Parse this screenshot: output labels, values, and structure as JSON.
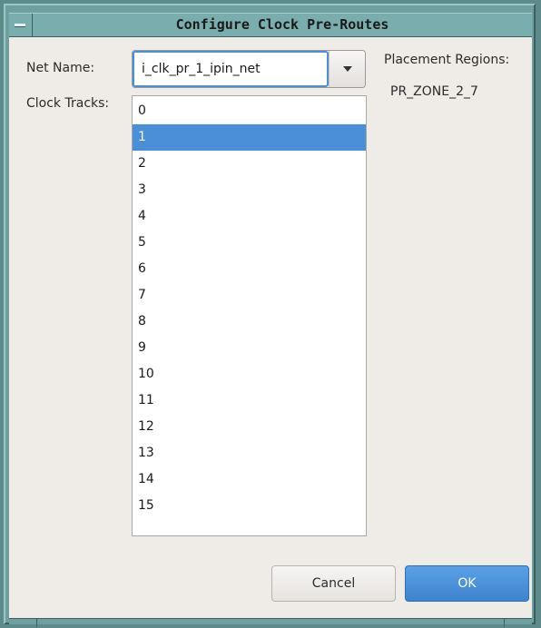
{
  "window": {
    "title": "Configure Clock Pre-Routes"
  },
  "form": {
    "net_name_label": "Net Name:",
    "net_name_value": "i_clk_pr_1_ipin_net",
    "clock_tracks_label": "Clock Tracks:",
    "placement_regions_label": "Placement Regions:",
    "placement_region_value": "PR_ZONE_2_7"
  },
  "clock_tracks": {
    "selected": "1",
    "items": [
      "0",
      "1",
      "2",
      "3",
      "4",
      "5",
      "6",
      "7",
      "8",
      "9",
      "10",
      "11",
      "12",
      "13",
      "14",
      "15"
    ]
  },
  "buttons": {
    "cancel_label": "Cancel",
    "ok_label": "OK"
  },
  "colors": {
    "accent": "#4a90d9",
    "frame": "#6f9f9f",
    "client_bg": "#efebe7"
  }
}
